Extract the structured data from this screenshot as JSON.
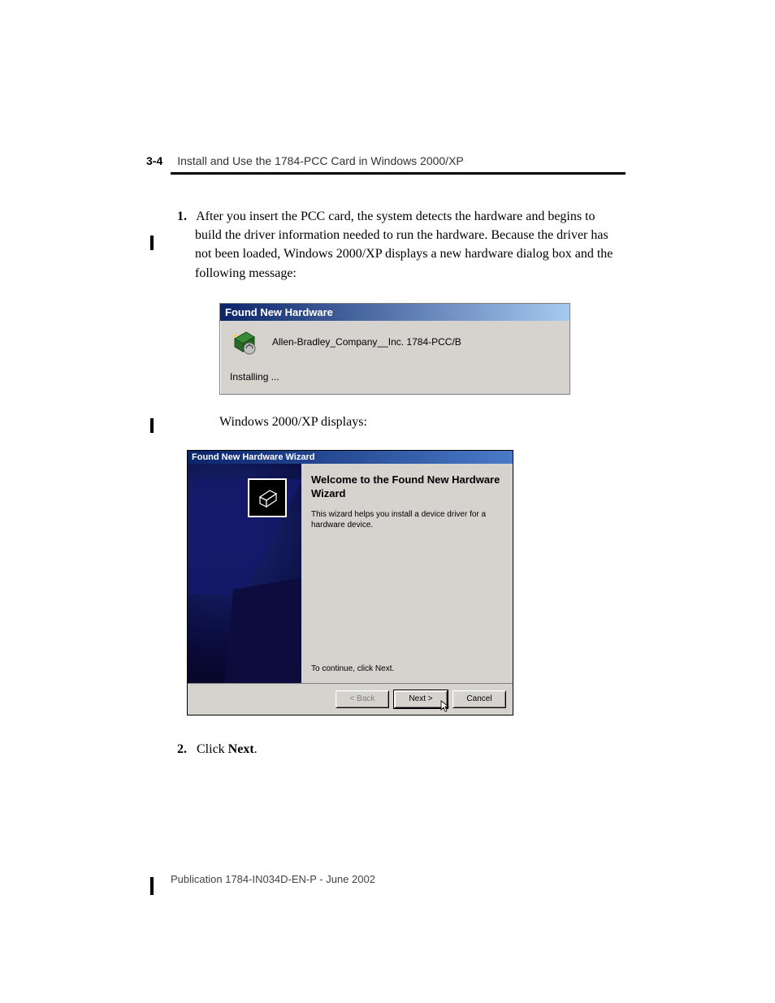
{
  "header": {
    "pageNumber": "3-4",
    "title": "Install and Use the 1784-PCC Card in Windows 2000/XP"
  },
  "step1": {
    "num": "1.",
    "text": "After you insert the PCC card, the system detects the hardware and begins to build the driver information needed to run the hardware. Because the driver has not been loaded, Windows 2000/XP displays a new hardware dialog box and the following message:"
  },
  "dialog1": {
    "title": "Found New Hardware",
    "device": "Allen-Bradley_Company__Inc. 1784-PCC/B",
    "status": "Installing ..."
  },
  "midText": "Windows 2000/XP displays:",
  "dialog2": {
    "title": "Found New Hardware Wizard",
    "heading": "Welcome to the Found New Hardware Wizard",
    "desc": "This wizard helps you install a device driver for a hardware device.",
    "continue": "To continue, click Next.",
    "buttons": {
      "back": "< Back",
      "next": "Next >",
      "cancel": "Cancel"
    }
  },
  "step2": {
    "num": "2.",
    "pre": "Click ",
    "bold": "Next",
    "post": "."
  },
  "footer": "Publication 1784-IN034D-EN-P - June 2002"
}
